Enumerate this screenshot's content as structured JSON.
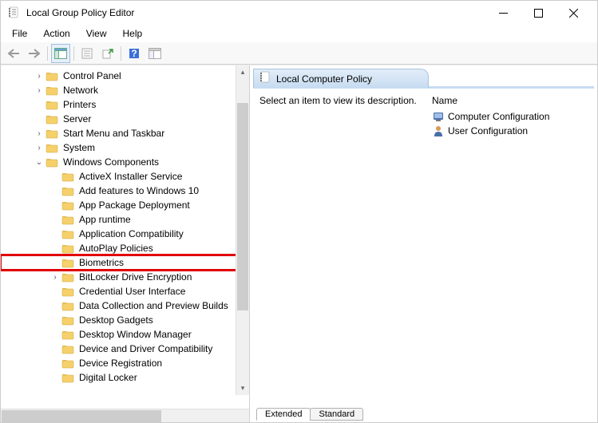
{
  "window": {
    "title": "Local Group Policy Editor"
  },
  "menubar": {
    "file": "File",
    "action": "Action",
    "view": "View",
    "help": "Help"
  },
  "tree": {
    "items": [
      {
        "indent": 40,
        "expander": "›",
        "label": "Control Panel"
      },
      {
        "indent": 40,
        "expander": "›",
        "label": "Network"
      },
      {
        "indent": 40,
        "expander": "",
        "label": "Printers"
      },
      {
        "indent": 40,
        "expander": "",
        "label": "Server"
      },
      {
        "indent": 40,
        "expander": "›",
        "label": "Start Menu and Taskbar"
      },
      {
        "indent": 40,
        "expander": "›",
        "label": "System"
      },
      {
        "indent": 40,
        "expander": "⌄",
        "label": "Windows Components"
      },
      {
        "indent": 60,
        "expander": "",
        "label": "ActiveX Installer Service"
      },
      {
        "indent": 60,
        "expander": "",
        "label": "Add features to Windows 10"
      },
      {
        "indent": 60,
        "expander": "",
        "label": "App Package Deployment"
      },
      {
        "indent": 60,
        "expander": "",
        "label": "App runtime"
      },
      {
        "indent": 60,
        "expander": "",
        "label": "Application Compatibility"
      },
      {
        "indent": 60,
        "expander": "",
        "label": "AutoPlay Policies"
      },
      {
        "indent": 60,
        "expander": "",
        "label": "Biometrics",
        "highlight": true
      },
      {
        "indent": 60,
        "expander": "›",
        "label": "BitLocker Drive Encryption"
      },
      {
        "indent": 60,
        "expander": "",
        "label": "Credential User Interface"
      },
      {
        "indent": 60,
        "expander": "",
        "label": "Data Collection and Preview Builds"
      },
      {
        "indent": 60,
        "expander": "",
        "label": "Desktop Gadgets"
      },
      {
        "indent": 60,
        "expander": "",
        "label": "Desktop Window Manager"
      },
      {
        "indent": 60,
        "expander": "",
        "label": "Device and Driver Compatibility"
      },
      {
        "indent": 60,
        "expander": "",
        "label": "Device Registration"
      },
      {
        "indent": 60,
        "expander": "",
        "label": "Digital Locker"
      }
    ]
  },
  "detail": {
    "header_title": "Local Computer Policy",
    "description_prompt": "Select an item to view its description.",
    "name_column": "Name",
    "items": [
      {
        "label": "Computer Configuration"
      },
      {
        "label": "User Configuration"
      }
    ]
  },
  "tabs": {
    "extended": "Extended",
    "standard": "Standard"
  }
}
